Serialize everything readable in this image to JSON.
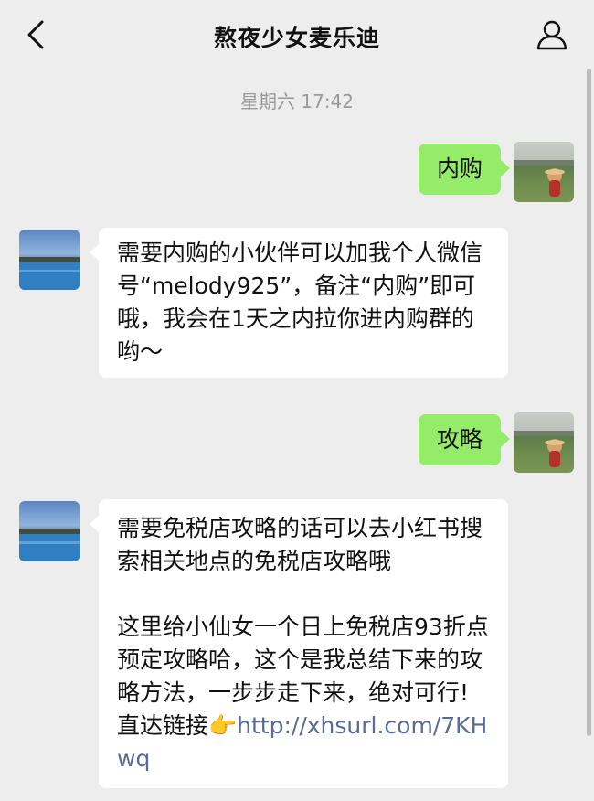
{
  "header": {
    "title": "熬夜少女麦乐迪"
  },
  "timestamp": "星期六 17:42",
  "messages": [
    {
      "sender": "self",
      "text": "内购"
    },
    {
      "sender": "other",
      "text": "需要内购的小伙伴可以加我个人微信号“melody925”，备注“内购”即可哦，我会在1天之内拉你进内购群的哟～"
    },
    {
      "sender": "self",
      "text": "攻略"
    },
    {
      "sender": "other",
      "para1": "需要免税店攻略的话可以去小红书搜索相关地点的免税店攻略哦",
      "para2_text": "这里给小仙女一个日上免税店93折点预定攻略哈，这个是我总结下来的攻略方法，一步步走下来，绝对可行!直达链接",
      "hand_emoji": "👉",
      "link": "http://xhsurl.com/7KHwq"
    }
  ],
  "colors": {
    "background": "#ededed",
    "self_bubble": "#95ec69",
    "other_bubble": "#ffffff",
    "link": "#576b95",
    "timestamp": "#9a9a9a"
  },
  "icons": {
    "back": "chevron-left-icon",
    "profile": "person-icon",
    "self_avatar": "avatar-photo-field",
    "other_avatar": "avatar-photo-pool"
  }
}
